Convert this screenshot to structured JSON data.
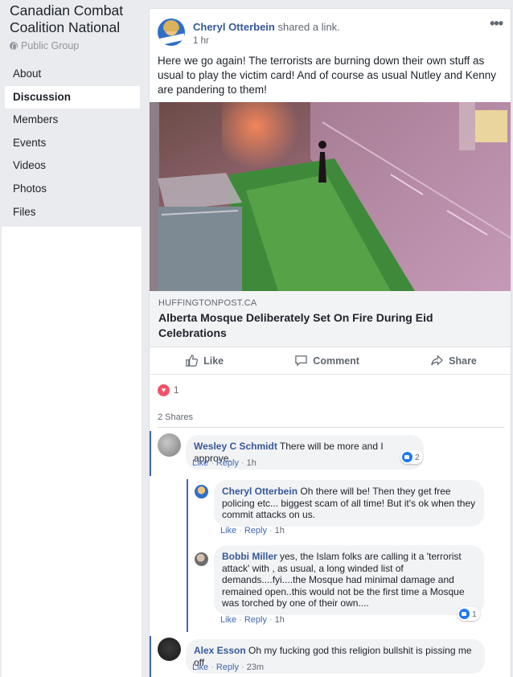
{
  "group": {
    "title": "Canadian Combat Coalition National",
    "privacy": "Public Group"
  },
  "nav": [
    {
      "label": "About",
      "active": false
    },
    {
      "label": "Discussion",
      "active": true
    },
    {
      "label": "Members",
      "active": false
    },
    {
      "label": "Events",
      "active": false
    },
    {
      "label": "Videos",
      "active": false
    },
    {
      "label": "Photos",
      "active": false
    },
    {
      "label": "Files",
      "active": false
    }
  ],
  "post": {
    "author": "Cheryl Otterbein",
    "verb": " shared a link.",
    "time": "1 hr",
    "more_icon": "more-options-icon",
    "text": "Here we go again! The terrorists are burning down their own stuff as usual to play the victim card! And of course as usual Nutley and Kenny are pandering to them!",
    "link": {
      "domain": "HUFFINGTONPOST.CA",
      "title": "Alberta Mosque Deliberately Set On Fire During Eid Celebrations"
    },
    "actions": {
      "like": "Like",
      "comment": "Comment",
      "share": "Share"
    },
    "reaction_count": "1",
    "shares": "2 Shares"
  },
  "comments": [
    {
      "author": "Wesley C Schmidt",
      "text": " There will be more and I approve.",
      "like": "Like",
      "reply": "Reply",
      "time": "1h",
      "reactions": "2"
    },
    {
      "author": "Cheryl Otterbein",
      "text": " Oh there will be! Then they get free policing etc... biggest scam of all time! But it's ok when they commit attacks on us.",
      "like": "Like",
      "reply": "Reply",
      "time": "1h"
    },
    {
      "author": "Bobbi Miller",
      "text": " yes, the Islam folks are calling it a 'terrorist attack' with , as usual, a long winded list of demands....fyi....the Mosque had minimal damage and remained open..this would not be the first time a Mosque was torched by one of their own....",
      "like": "Like",
      "reply": "Reply",
      "time": "1h",
      "reactions": "1"
    },
    {
      "author": "Alex Esson",
      "text": " Oh my fucking god this religion bullshit is pissing me off",
      "like": "Like",
      "reply": "Reply",
      "time": "23m"
    }
  ],
  "colors": {
    "link_blue": "#365899",
    "thread_bar": "#4267b2",
    "page_bg": "#e9ebee",
    "love": "#f25268",
    "like": "#2078f4"
  }
}
